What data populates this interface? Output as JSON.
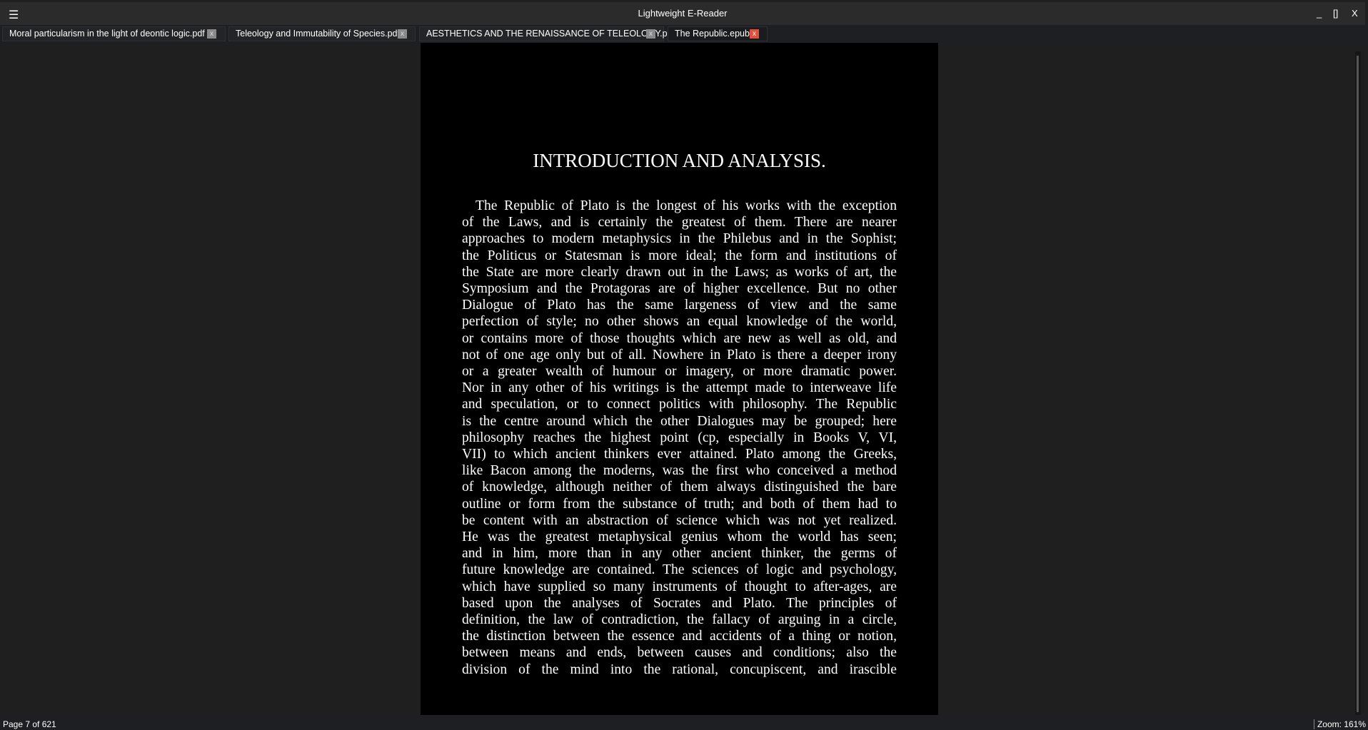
{
  "window": {
    "title": "Lightweight E-Reader",
    "menu_icon": "☰",
    "minimize": "_",
    "maximize": "[]",
    "close": "X"
  },
  "tabs": [
    {
      "label": "Moral particularism in the light of deontic logic.pdf",
      "close": "x"
    },
    {
      "label": "Teleology and Immutability of Species.pdf",
      "close": "x"
    },
    {
      "label": "AESTHETICS AND THE RENAISSANCE OF TELEOLOGY.pdf",
      "close": "x"
    },
    {
      "label": "The Republic.epub",
      "close": "x"
    }
  ],
  "document": {
    "heading": "INTRODUCTION AND ANALYSIS.",
    "lines": [
      "The Republic of Plato is the longest of his works with the exception",
      "of the Laws, and is certainly the greatest of them. There are nearer",
      "approaches to modern metaphysics in the Philebus and in the Sophist;",
      "the Politicus or Statesman is more ideal; the form and institutions of",
      "the State are more clearly drawn out in the Laws; as works of art, the",
      "Symposium and the Protagoras are of higher excellence. But no other",
      "Dialogue of Plato has the same largeness of view and the same",
      "perfection of style; no other shows an equal knowledge of the world,",
      "or contains more of those thoughts which are new as well as old, and",
      "not of one age only but of all. Nowhere in Plato is there a deeper irony",
      "or a greater wealth of humour or imagery, or more dramatic power.",
      "Nor in any other of his writings is the attempt made to interweave life",
      "and speculation, or to connect politics with philosophy. The Republic",
      "is the centre around which the other Dialogues may be grouped; here",
      "philosophy reaches the highest point (cp, especially in Books V, VI,",
      "VII) to which ancient thinkers ever attained. Plato among the Greeks,",
      "like Bacon among the moderns, was the first who conceived a method",
      "of knowledge, although neither of them always distinguished the bare",
      "outline or form from the substance of truth; and both of them had to",
      "be content with an abstraction of science which was not yet realized.",
      "He was the greatest metaphysical genius whom the world has seen;",
      "and in him, more than in any other ancient thinker, the germs of",
      "future knowledge are contained. The sciences of logic and psychology,",
      "which have supplied so many instruments of thought to after-ages, are",
      "based upon the analyses of Socrates and Plato. The principles of",
      "definition, the law of contradiction, the fallacy of arguing in a circle,",
      "the distinction between the essence and accidents of a thing or notion,",
      "between means and ends, between causes and conditions; also the",
      "division of the mind into the rational, concupiscent, and irascible"
    ]
  },
  "status": {
    "page": "Page 7 of 621",
    "zoom": "Zoom: 161%"
  },
  "colors": {
    "active_close": "#e0503c",
    "titlebar": "#2b2b2b",
    "page": "#000000"
  }
}
